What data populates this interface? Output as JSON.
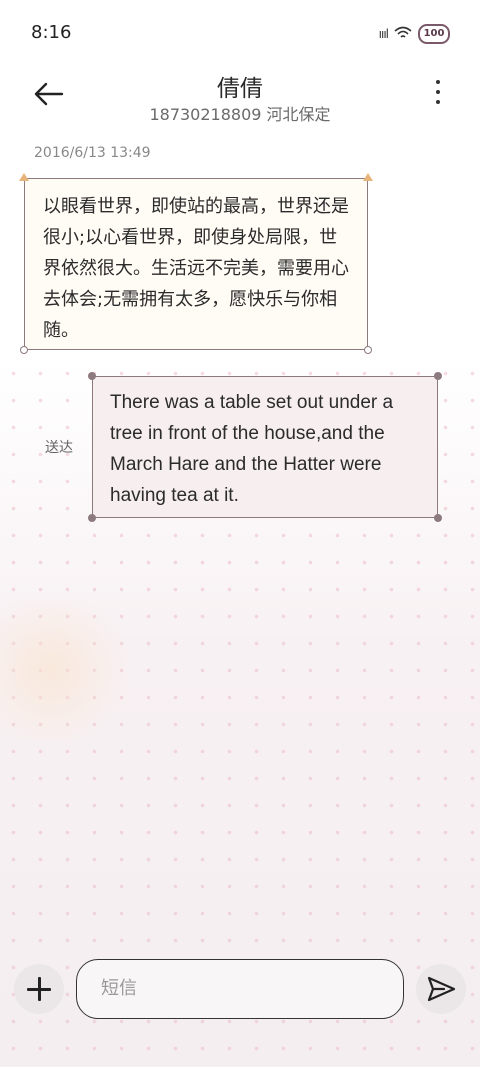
{
  "status_bar": {
    "time": "8:16",
    "signal_text": "ıııl",
    "battery": "100"
  },
  "header": {
    "contact_name": "倩倩",
    "contact_info": "18730218809 河北保定"
  },
  "messages": [
    {
      "direction": "incoming",
      "timestamp": "2016/6/13 13:49",
      "text": "以眼看世界，即使站的最高，世界还是很小;以心看世界，即使身处局限，世界依然很大。生活远不完美，需要用心去体会;无需拥有太多，愿快乐与你相随。"
    },
    {
      "direction": "outgoing",
      "status": "送达",
      "text": "There was a table set out under a tree in front of the house,and the March Hare and the Hatter were having tea at it."
    }
  ],
  "composer": {
    "placeholder": "短信"
  },
  "colors": {
    "bubble_border": "#8d7a7f",
    "incoming_bg": "#fffcf6",
    "outgoing_bg": "#f7eef0",
    "accent": "#e7b57a"
  }
}
